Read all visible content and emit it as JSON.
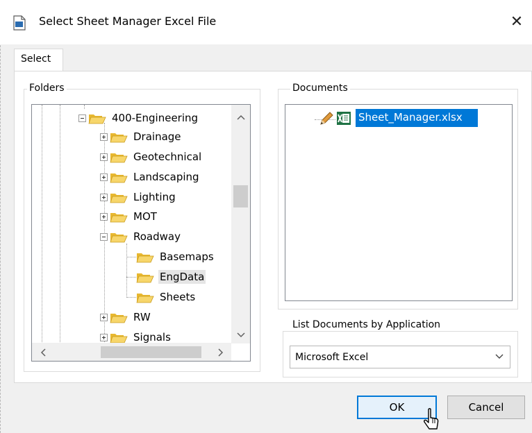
{
  "window": {
    "title": "Select Sheet Manager Excel File",
    "close_glyph": "✕"
  },
  "tabs": [
    {
      "label": "Select"
    }
  ],
  "folders": {
    "group_label": "Folders",
    "items": [
      {
        "label": "400-Engineering",
        "expander": "minus"
      },
      {
        "label": "Drainage",
        "expander": "plus"
      },
      {
        "label": "Geotechnical",
        "expander": "plus"
      },
      {
        "label": "Landscaping",
        "expander": "plus"
      },
      {
        "label": "Lighting",
        "expander": "plus"
      },
      {
        "label": "MOT",
        "expander": "plus"
      },
      {
        "label": "Roadway",
        "expander": "minus"
      },
      {
        "label": "Basemaps",
        "expander": "none"
      },
      {
        "label": "EngData",
        "expander": "none",
        "selected": true
      },
      {
        "label": "Sheets",
        "expander": "none"
      },
      {
        "label": "RW",
        "expander": "plus"
      },
      {
        "label": "Signals",
        "expander": "plus"
      }
    ]
  },
  "documents": {
    "group_label": "Documents",
    "items": [
      {
        "label": "Sheet_Manager.xlsx",
        "selected": true
      }
    ]
  },
  "application_filter": {
    "group_label": "List Documents by Application",
    "selected": "Microsoft Excel"
  },
  "buttons": {
    "ok": "OK",
    "cancel": "Cancel"
  },
  "colors": {
    "selection": "#0078d7",
    "folder": "#f5c542",
    "excel": "#1f7244"
  }
}
